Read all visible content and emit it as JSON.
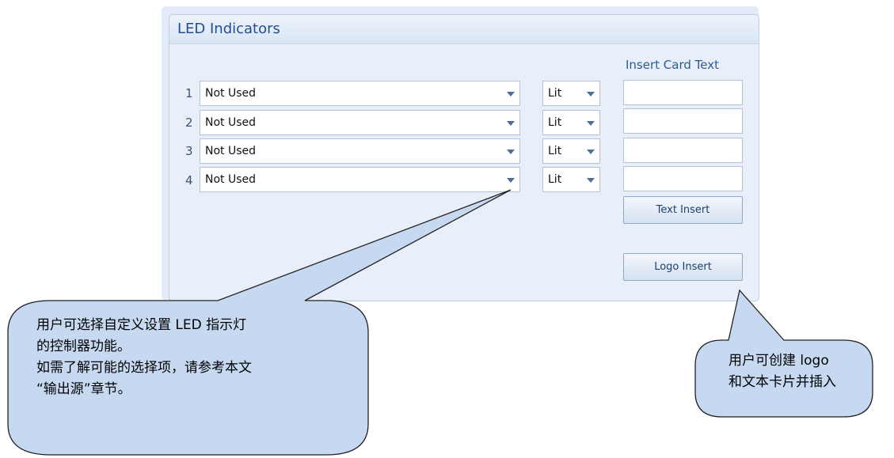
{
  "panel": {
    "title": "LED Indicators",
    "column_header": "Insert Card Text"
  },
  "rows": [
    {
      "number": "1",
      "function": "Not Used",
      "state": "Lit"
    },
    {
      "number": "2",
      "function": "Not Used",
      "state": "Lit"
    },
    {
      "number": "3",
      "function": "Not Used",
      "state": "Lit"
    },
    {
      "number": "4",
      "function": "Not Used",
      "state": "Lit"
    }
  ],
  "buttons": {
    "text_insert": "Text Insert",
    "logo_insert": "Logo Insert"
  },
  "callouts": {
    "left": {
      "line1": "用户可选择自定义设置 LED 指示灯",
      "line2": "的控制器功能。",
      "line3": "如需了解可能的选择项，请参考本文",
      "line4": "“输出源”章节。"
    },
    "right": {
      "line1": "用户可创建 logo",
      "line2": "和文本卡片并插入"
    }
  },
  "colors": {
    "panel_bg": "#e9eff8",
    "title": "#1f4f90",
    "callout_fill": "#c6d9f1"
  }
}
